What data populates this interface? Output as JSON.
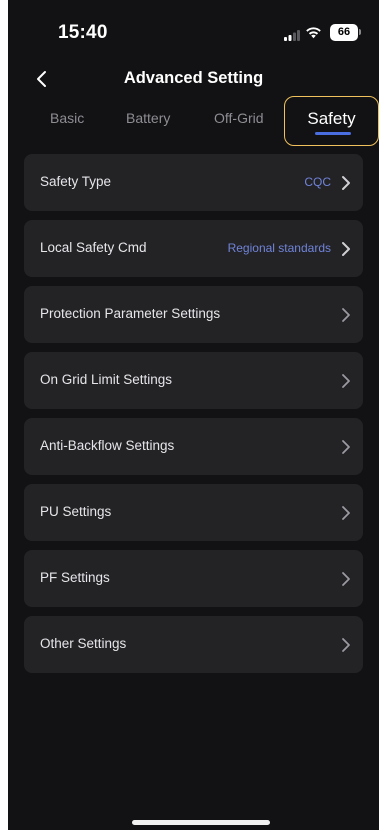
{
  "status_bar": {
    "time": "15:40",
    "battery_level": "66"
  },
  "nav": {
    "title": "Advanced Setting"
  },
  "tabs": [
    {
      "label": "Basic"
    },
    {
      "label": "Battery"
    },
    {
      "label": "Off-Grid"
    },
    {
      "label": "Safety",
      "active": true
    }
  ],
  "rows": [
    {
      "label": "Safety Type",
      "value": "CQC"
    },
    {
      "label": "Local Safety Cmd",
      "value": "Regional standards"
    },
    {
      "label": "Protection Parameter Settings"
    },
    {
      "label": "On Grid Limit Settings"
    },
    {
      "label": "Anti-Backflow Settings"
    },
    {
      "label": "PU Settings"
    },
    {
      "label": "PF Settings"
    },
    {
      "label": "Other Settings"
    }
  ],
  "colors": {
    "background": "#121214",
    "card": "#232326",
    "accent_value": "#7083d8",
    "active_tab_border": "#f0c15c",
    "active_tab_underline": "#4a6ee0"
  },
  "icons": [
    "back-chevron-icon",
    "signal-icon",
    "wifi-icon",
    "battery-icon",
    "chevron-right-icon"
  ]
}
